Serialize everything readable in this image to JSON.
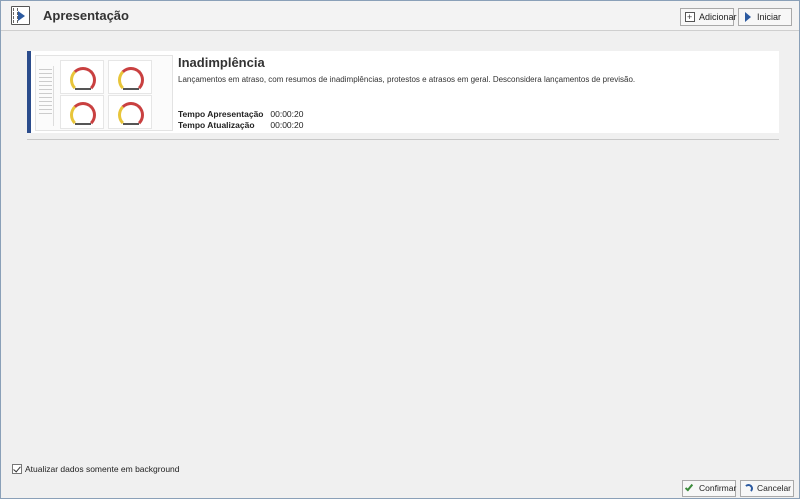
{
  "header": {
    "title": "Apresentação",
    "add_label": "Adicionar",
    "start_label": "Iniciar"
  },
  "presentation": {
    "title": "Inadimplência",
    "description": "Lançamentos em atraso, com resumos de inadimplências, protestos e atrasos em geral. Desconsidera lançamentos de previsão.",
    "metrics": [
      {
        "label": "Tempo Apresentação",
        "value": "00:00:20"
      },
      {
        "label": "Tempo Atualização",
        "value": "00:00:20"
      }
    ]
  },
  "footer": {
    "background_checkbox_label": "Atualizar dados somente em background",
    "background_checked": true,
    "confirm_label": "Confirmar",
    "cancel_label": "Cancelar"
  },
  "colors": {
    "accent": "#2b4c8c",
    "gauge_red": "#c94040",
    "gauge_yellow": "#e8c53a"
  }
}
